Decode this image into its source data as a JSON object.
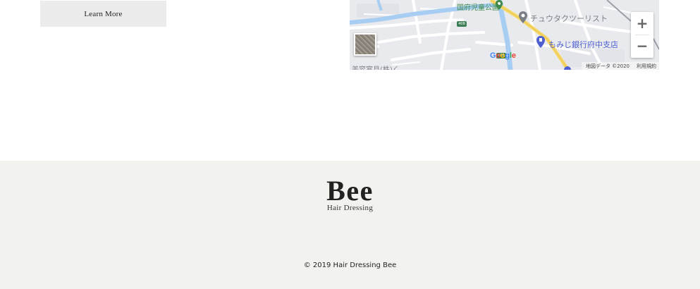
{
  "content": {
    "learn_more_label": "Learn More"
  },
  "map": {
    "labels": {
      "park": "国府児童公園",
      "tour": "チュウタクツーリスト",
      "bank": "もみじ銀行府中支店",
      "cut_off": "美容室月(株)く"
    },
    "road_shields": [
      "408",
      "408"
    ],
    "google_logo_letters": [
      "G",
      "o",
      "o",
      "g",
      "l",
      "e"
    ],
    "google_logo_colors": [
      "#4285F4",
      "#EA4335",
      "#FBBC05",
      "#4285F4",
      "#34A853",
      "#EA4335"
    ],
    "zoom_in": "+",
    "zoom_out": "−",
    "attribution": "地図データ ©2020",
    "terms": "利用規約",
    "colors": {
      "background": "#e9eaee",
      "road": "#ffffff",
      "highway": "#f6d96b",
      "water": "#a7cdf2",
      "park_pin": "#3f8a4a",
      "poi_pin": "#7a7f86",
      "bank_pin": "#4d5fd1"
    },
    "icons": [
      "park-pin-icon",
      "location-pin-icon",
      "bank-pin-icon",
      "satellite-thumbnail-icon"
    ]
  },
  "footer": {
    "brand_name": "Bee",
    "brand_subtitle": "Hair Dressing",
    "copyright": "© 2019 Hair Dressing Bee",
    "background": "#f2f2ef"
  }
}
